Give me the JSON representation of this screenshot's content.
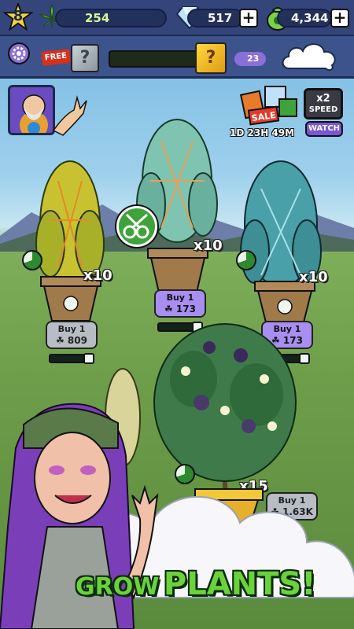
{
  "hud": {
    "level": "8",
    "weed_count": "254",
    "gems": "517",
    "cash": "4,344",
    "gem_progress_count": "23",
    "free_label": "FREE",
    "plus_label": "+",
    "mystery_mark": "?"
  },
  "offer": {
    "sale_label": "SALE",
    "timer": "1D 23H 49M",
    "speed_label": "x2",
    "speed_sub": "SPEED",
    "watch_label": "WATCH"
  },
  "plants": [
    {
      "multiplier": "x10",
      "buy_label": "Buy 1",
      "price": "809",
      "buy_style": "grey"
    },
    {
      "multiplier": "x10",
      "buy_label": "Buy 1",
      "price": "173",
      "buy_style": "purple"
    },
    {
      "multiplier": "x10",
      "buy_label": "Buy 1",
      "price": "173",
      "buy_style": "purple"
    },
    {
      "multiplier": "x15",
      "buy_label": "Buy 1",
      "price": "1.63K",
      "buy_style": "grey"
    }
  ],
  "headline": {
    "line1": "GROW",
    "line2": "PLANTS!"
  },
  "colors": {
    "topbar": "#33457a",
    "accent_green": "#6ad23a",
    "button_purple": "#a78ef0"
  },
  "icons": [
    "settings-gear-icon",
    "diamond-gem-icon",
    "cash-bag-icon",
    "leaf-icon",
    "mystery-box-icon",
    "shears-icon"
  ]
}
